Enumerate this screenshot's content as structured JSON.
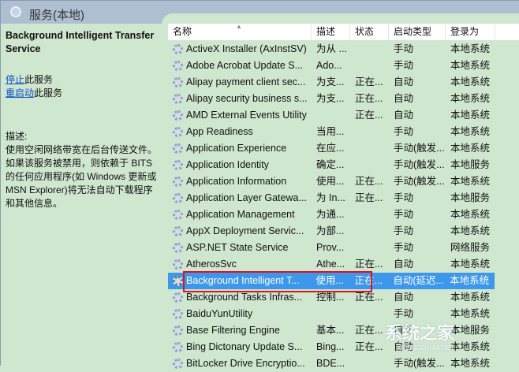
{
  "title": "服务(本地)",
  "left": {
    "service_name": "Background Intelligent Transfer Service",
    "stop_link": "停止",
    "stop_suffix": "此服务",
    "restart_link": "重启动",
    "restart_suffix": "此服务",
    "desc_label": "描述:",
    "desc_text": "使用空闲网络带宽在后台传送文件。如果该服务被禁用，则依赖于 BITS 的任何应用程序(如 Windows 更新或 MSN Explorer)将无法自动下载程序和其他信息。"
  },
  "columns": [
    "名称",
    "描述",
    "状态",
    "启动类型",
    "登录为"
  ],
  "rows": [
    [
      "ActiveX Installer (AxInstSV)",
      "为从 ...",
      "",
      "手动",
      "本地系统"
    ],
    [
      "Adobe Acrobat Update S...",
      "Ado...",
      "",
      "手动",
      "本地系统"
    ],
    [
      "Alipay payment client sec...",
      "为支...",
      "正在...",
      "自动",
      "本地系统"
    ],
    [
      "Alipay security business s...",
      "为支...",
      "正在...",
      "自动",
      "本地系统"
    ],
    [
      "AMD External Events Utility",
      "",
      "正在...",
      "自动",
      "本地系统"
    ],
    [
      "App Readiness",
      "当用...",
      "",
      "手动",
      "本地系统"
    ],
    [
      "Application Experience",
      "在应...",
      "",
      "手动(触发...",
      "本地系统"
    ],
    [
      "Application Identity",
      "确定...",
      "",
      "手动(触发...",
      "本地服务"
    ],
    [
      "Application Information",
      "使用...",
      "正在...",
      "手动(触发...",
      "本地系统"
    ],
    [
      "Application Layer Gatewa...",
      "为 In...",
      "正在...",
      "手动",
      "本地服务"
    ],
    [
      "Application Management",
      "为通...",
      "",
      "手动",
      "本地系统"
    ],
    [
      "AppX Deployment Servic...",
      "为部...",
      "",
      "手动",
      "本地系统"
    ],
    [
      "ASP.NET State Service",
      "Prov...",
      "",
      "手动",
      "网络服务"
    ],
    [
      "AtherosSvc",
      "Athe...",
      "正在...",
      "自动",
      "本地系统"
    ],
    [
      "Background Intelligent T...",
      "使用...",
      "正在...",
      "自动(延迟...",
      "本地系统"
    ],
    [
      "Background Tasks Infras...",
      "控制...",
      "正在...",
      "自动",
      "本地系统"
    ],
    [
      "BaiduYunUtility",
      "",
      "",
      "手动",
      "本地系统"
    ],
    [
      "Base Filtering Engine",
      "基本...",
      "正在...",
      "自动",
      "本地服务"
    ],
    [
      "Bing Dictonary Update S...",
      "Bing...",
      "正在...",
      "自动",
      "本地系统"
    ],
    [
      "BitLocker Drive Encryptio...",
      "BDE...",
      "",
      "手动(触发...",
      "本地系统"
    ]
  ],
  "selected_index": 14,
  "watermark": {
    "text": "系统之家",
    "sub": "XITONGZHIJIA.NET"
  }
}
